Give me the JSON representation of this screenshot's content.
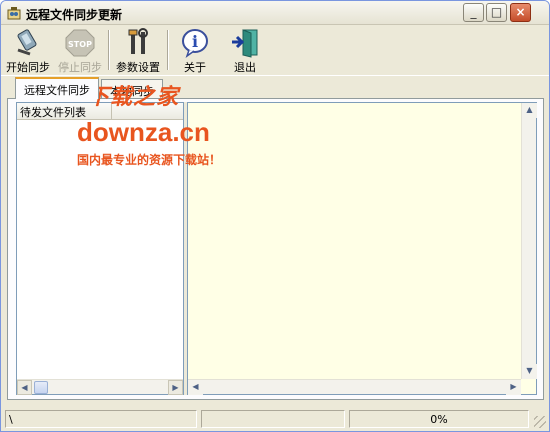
{
  "window": {
    "title": "远程文件同步更新"
  },
  "titlebar": {
    "min": "0",
    "max": "□",
    "close": "×"
  },
  "toolbar": {
    "start": "开始同步",
    "stop": "停止同步",
    "params": "参数设置",
    "about": "关于",
    "exit": "退出"
  },
  "tabs": [
    {
      "label": "远程文件同步",
      "active": true
    },
    {
      "label": "本地同步"
    }
  ],
  "left_list": {
    "column": "待发文件列表"
  },
  "watermark": {
    "line1": "下载之家",
    "line2": "downza.cn",
    "line3": "国内最专业的资源下载站！"
  },
  "status": {
    "panel1": "\\",
    "progress": "0%"
  },
  "scroll": {
    "left": "◀",
    "right": "▶",
    "up": "▲",
    "down": "▼"
  }
}
